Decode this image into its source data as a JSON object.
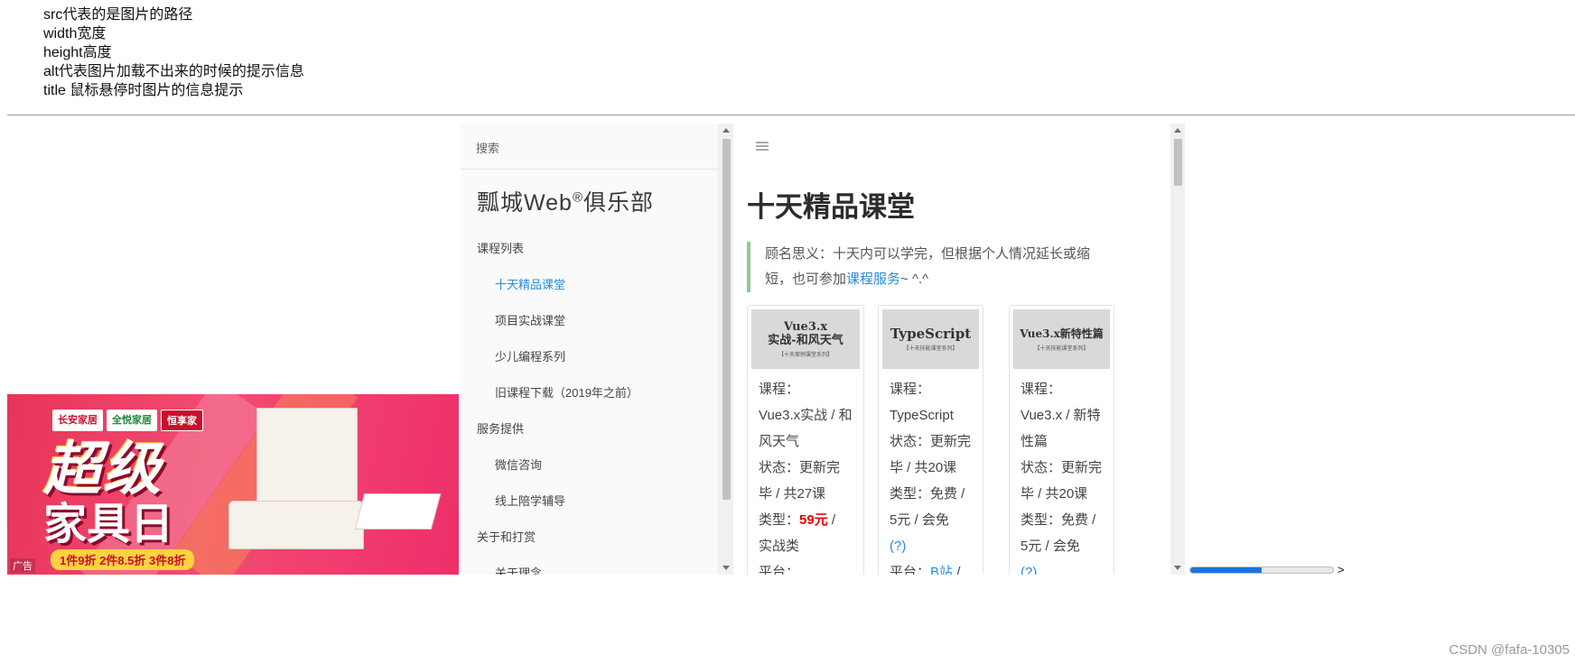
{
  "notes": [
    "src代表的是图片的路径",
    "width宽度",
    "height高度",
    "alt代表图片加载不出来的时候的提示信息",
    "title 鼠标悬停时图片的信息提示"
  ],
  "ad": {
    "brands": [
      "长安家居",
      "全悦家居",
      "恒享家"
    ],
    "headline_line1": "超级",
    "headline_line2": "家具日",
    "promo": "1件9折 2件8.5折 3件8折",
    "tag": "广告"
  },
  "docs": {
    "search_placeholder": "搜索",
    "logo_text": "瓢城Web",
    "logo_mark": "®",
    "logo_suffix": "俱乐部",
    "nav": [
      {
        "label": "课程列表",
        "level": "group"
      },
      {
        "label": "十天精品课堂",
        "level": "sub",
        "active": true
      },
      {
        "label": "项目实战课堂",
        "level": "sub"
      },
      {
        "label": "少儿编程系列",
        "level": "sub"
      },
      {
        "label": "旧课程下载（2019年之前）",
        "level": "sub"
      },
      {
        "label": "服务提供",
        "level": "group"
      },
      {
        "label": "微信咨询",
        "level": "sub"
      },
      {
        "label": "线上陪学辅导",
        "level": "sub"
      },
      {
        "label": "关于和打赏",
        "level": "group"
      },
      {
        "label": "关于理念",
        "level": "sub"
      }
    ],
    "page_title": "十天精品课堂",
    "quote_before": "顾名思义：十天内可以学完，但根据个人情况延长或缩短，也可参加",
    "quote_link": "课程服务",
    "quote_after": "~ ^.^",
    "cards": [
      {
        "cover_title": "Vue3.x\n实战-和风天气",
        "cover_sub": "【十天案例课堂系列】",
        "course_label": "课程：",
        "course": "Vue3.x实战 / 和风天气",
        "status": "状态：更新完毕 / 共27课",
        "type_label": "类型：",
        "price": "59元",
        "type_rest": " / 实战类",
        "platform": "平台："
      },
      {
        "cover_title": "TypeScript",
        "cover_sub": "【十天技能课堂系列】",
        "course_label": "课程：",
        "course": "TypeScript",
        "status": "状态：更新完毕 / 共20课",
        "type_label": "类型：免费 / 5元 / 会免",
        "help": "(?)",
        "platform": "平台：",
        "platform_link": "B站",
        "platform_rest": " /"
      },
      {
        "cover_title": "Vue3.x新特性篇",
        "cover_sub": "【十天技能课堂系列】",
        "course_label": "课程：",
        "course": "Vue3.x / 新特性篇",
        "status": "状态：更新完毕 / 共20课",
        "type_label": "类型：免费 / 5元 / 会免",
        "help": "(?)"
      }
    ]
  },
  "progress": {
    "value": 0.5,
    "arrow": ">"
  },
  "watermark": "CSDN @fafa-10305",
  "colors": {
    "accent": "#2a8bd8",
    "price": "#e60000",
    "quote_border": "#8ecb8e",
    "progress": "#1a73e8"
  }
}
